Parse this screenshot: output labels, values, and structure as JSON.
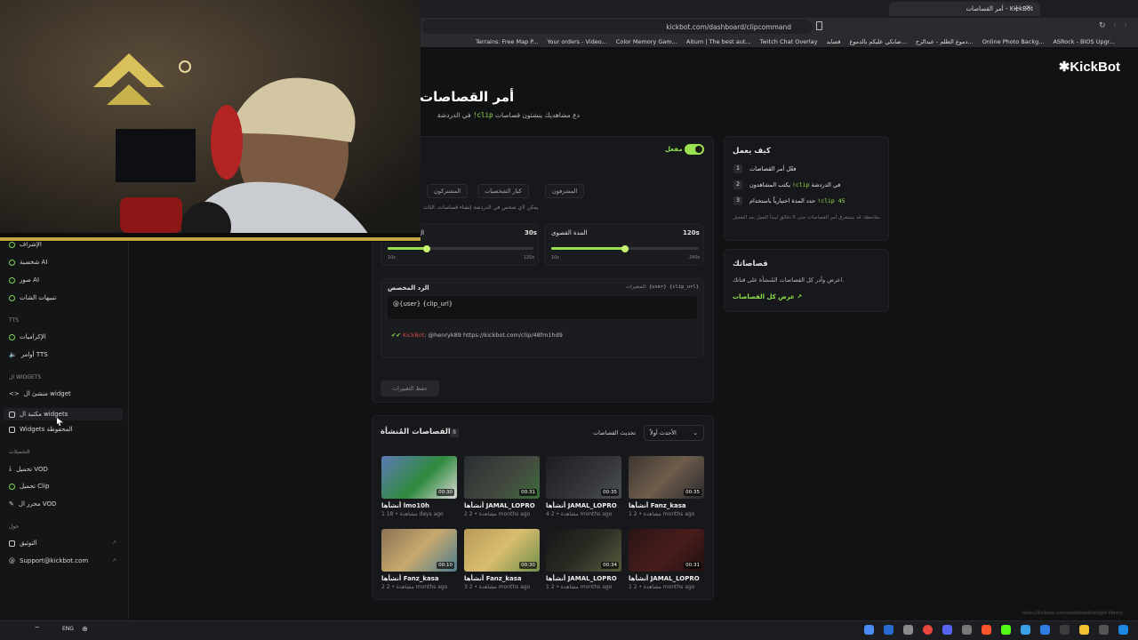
{
  "browser": {
    "tab_title": "أمر القصاصات - KickBot",
    "url": "kickbot.com/dashboard/clipcommand",
    "bookmarks": [
      "Terrains: Free Map P...",
      "Your orders - Video...",
      "Color Memory Gam...",
      "Aitum | The best aut...",
      "Twitch Chat Overlay",
      "قصايد",
      "صابكي عليكم بالدموع...",
      "دموع الظلم - عبدالرح...",
      "Online Photo Backg...",
      "ASRock - BIOS Upgr..."
    ]
  },
  "brand": {
    "name": "KickBot"
  },
  "sidebar": {
    "items_top": [
      {
        "label": "الإشراف"
      },
      {
        "label": "شخصية AI"
      },
      {
        "label": "صور AI"
      },
      {
        "label": "تنبيهات الشات"
      }
    ],
    "section_tts": "TTS",
    "items_tts": [
      {
        "label": "الإكراميات"
      },
      {
        "label": "أوامر TTS"
      }
    ],
    "section_widgets": "ال WIDGETS",
    "items_widgets": [
      {
        "label": "منشئ ال widget"
      },
      {
        "label": "مكتبة ال widgets"
      },
      {
        "label": "Widgets المحفوظة"
      }
    ],
    "section_downloads": "التحميلات",
    "items_downloads": [
      {
        "label": "تحميل VOD"
      },
      {
        "label": "تحميل Clip"
      },
      {
        "label": "محرر ال VOD"
      }
    ],
    "section_about": "حول",
    "items_about": [
      {
        "label": "التوثيق"
      },
      {
        "label": "Support@kickbot.com"
      }
    ]
  },
  "header": {
    "title": "أمر القصاصات",
    "subtitle_prefix": "في الدردشة",
    "subtitle_cmd": "!clip",
    "subtitle_rest": "دع مشاهديك ينشئون قصاصات"
  },
  "settings": {
    "toggle_label": "مفعل",
    "roles": [
      "المشرفون",
      "كبار الشخصيات",
      "المشتركون"
    ],
    "roles_hint": "يمكن لأي شخص في الدردشة إنشاء قصاصات. الثأت",
    "max_duration_label": "المدة القصوى",
    "max_duration_value": "120s",
    "max_min": "10s",
    "max_max": "240s",
    "max_fraction": 0.5,
    "default_label": "ال",
    "default_value": "30s",
    "default_min": "10s",
    "default_max": "120s",
    "default_fraction": 0.27,
    "reply_label": "الرد المخصص",
    "variables_label": "المتغيرات:",
    "variables": "{user} {clip_url}",
    "reply_value": "@{user} {clip_url}",
    "preview_user": "KickBot",
    "preview_text": ": @henryk89 https://kickbot.com/clip/48fm1hd9",
    "save_label": "حفظ التغييرات"
  },
  "how": {
    "title": "كيف يعمل",
    "steps": [
      {
        "n": "1",
        "text": "فعّل أمر القصاصات"
      },
      {
        "n": "2",
        "text": "يكتب المشاهدون",
        "cmd": "!clip",
        "tail": "في الدردشة"
      },
      {
        "n": "3",
        "text": "حدد المدة اختيارياً باستخدام",
        "cmd": "!clip 45"
      }
    ],
    "note": "ملاحظة: قد يستغرق أمر القصاصات حتى 5 دقائق ليبدأ العمل بعد التفعيل."
  },
  "clips_card": {
    "title": "قصاصاتك",
    "text": "اعرض وأدر كل القصاصات المُنشأة على قناتك.",
    "link": "عرض كل القصاصات"
  },
  "created": {
    "title": "القصاصات المُنشأة",
    "count": "8",
    "refresh": "تحديث القصاصات",
    "sort": "الأحدث أولاً",
    "clips": [
      {
        "author": "أنشأها lmo10h",
        "meta": "1 مشاهدة • 18 days ago",
        "dur": "00:30"
      },
      {
        "author": "أنشأها JAMAL_LOPRO",
        "meta": "2 مشاهدة • 2 months ago",
        "dur": "00:31"
      },
      {
        "author": "أنشأها JAMAL_LOPRO",
        "meta": "4 مشاهدة • 2 months ago",
        "dur": "00:35"
      },
      {
        "author": "أنشأها Fanz_kasa",
        "meta": "1 مشاهدة • 2 months ago",
        "dur": "00:35"
      },
      {
        "author": "أنشأها Fanz_kasa",
        "meta": "2 مشاهدة • 2 months ago",
        "dur": "00:10"
      },
      {
        "author": "أنشأها Fanz_kasa",
        "meta": "3 مشاهدة • 2 months ago",
        "dur": "00:30"
      },
      {
        "author": "أنشأها JAMAL_LOPRO",
        "meta": "1 مشاهدة • 2 months ago",
        "dur": "00:34"
      },
      {
        "author": "أنشأها JAMAL_LOPRO",
        "meta": "1 مشاهدة • 2 months ago",
        "dur": "00:31"
      }
    ]
  },
  "status_url": "https://kickbot.com/dashboard/widget-library",
  "taskbar": {
    "lang": "ENG"
  },
  "colors": {
    "accent": "#9be14f",
    "bg": "#111214"
  }
}
